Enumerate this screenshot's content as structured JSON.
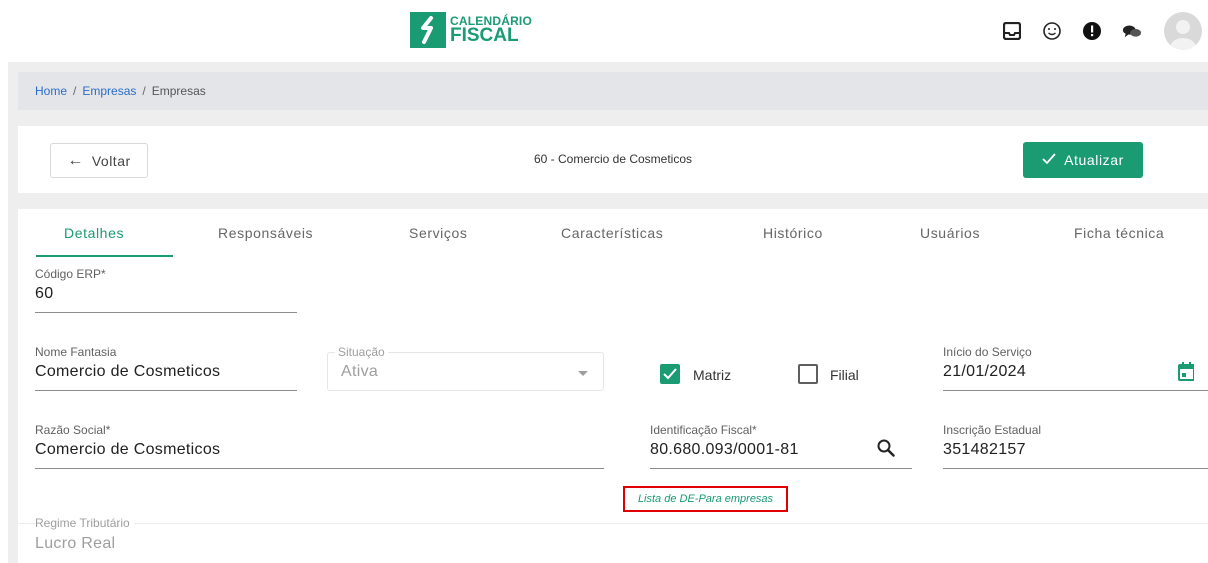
{
  "header": {
    "logo": {
      "line1": "CALENDÁRIO",
      "line2": "FISCAL",
      "brand_color": "#1a9b72"
    },
    "icons": [
      "inbox-icon",
      "smiley-icon",
      "alert-icon",
      "chat-icon",
      "user-avatar"
    ]
  },
  "breadcrumb": {
    "home": "Home",
    "sep": "/",
    "section": "Empresas",
    "current": "Empresas"
  },
  "toolbar": {
    "back_label": "Voltar",
    "title": "60 - Comercio de Cosmeticos",
    "update_label": "Atualizar"
  },
  "tabs": [
    {
      "label": "Detalhes",
      "active": true
    },
    {
      "label": "Responsáveis"
    },
    {
      "label": "Serviços"
    },
    {
      "label": "Características"
    },
    {
      "label": "Histórico"
    },
    {
      "label": "Usuários"
    },
    {
      "label": "Ficha técnica"
    }
  ],
  "form": {
    "codigo_erp": {
      "label": "Código ERP*",
      "value": "60"
    },
    "nome_fantasia": {
      "label": "Nome Fantasia",
      "value": "Comercio de Cosmeticos"
    },
    "situacao": {
      "label": "Situação",
      "value": "Ativa"
    },
    "matriz": {
      "label": "Matriz",
      "checked": true
    },
    "filial": {
      "label": "Filial",
      "checked": false
    },
    "inicio_servico": {
      "label": "Início do Serviço",
      "value": "21/01/2024"
    },
    "razao_social": {
      "label": "Razão Social*",
      "value": "Comercio de Cosmeticos"
    },
    "identificacao_fiscal": {
      "label": "Identificação Fiscal*",
      "value": "80.680.093/0001-81"
    },
    "inscricao_estadual": {
      "label": "Inscrição Estadual",
      "value": "351482157"
    },
    "de_para_link": "Lista de DE-Para empresas",
    "regime_tributario": {
      "label": "Regime Tributário",
      "value": "Lucro Real"
    }
  },
  "colors": {
    "accent": "#1a9b72",
    "highlight_border": "#e00000"
  }
}
